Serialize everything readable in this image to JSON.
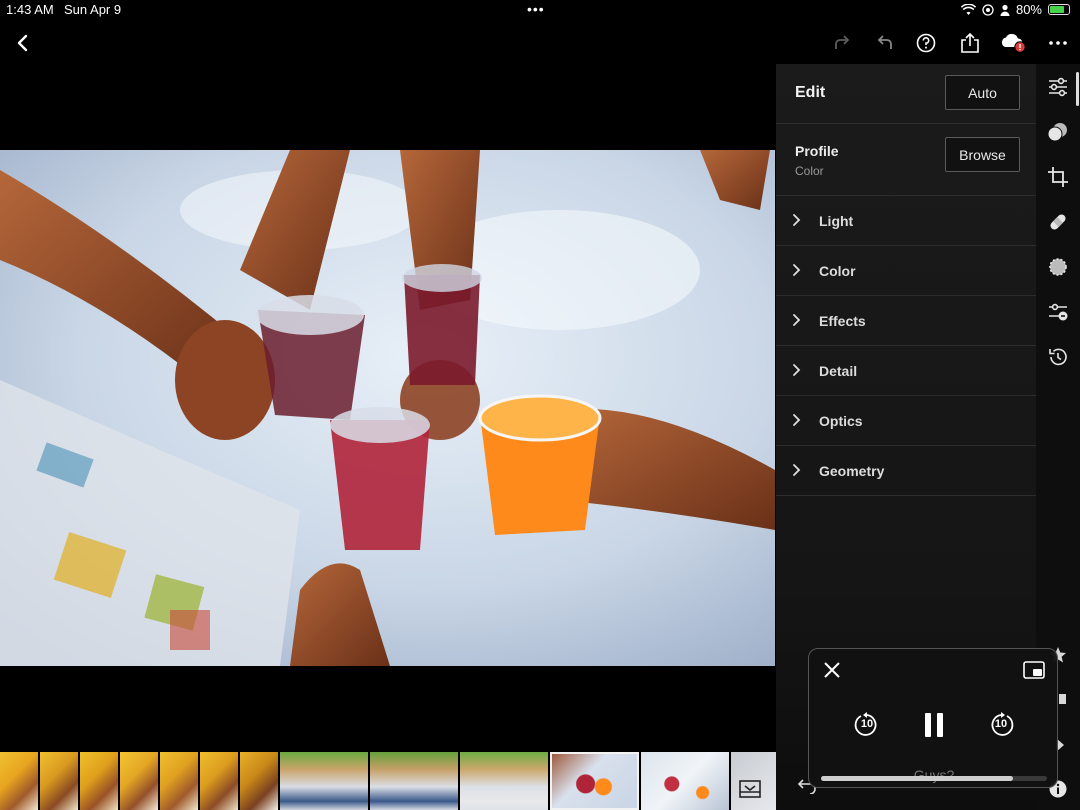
{
  "status_bar": {
    "time": "1:43 AM",
    "date": "Sun Apr 9",
    "battery": "80%",
    "battery_level": 0.8
  },
  "toolbar": {
    "back_icon": "chevron-left-icon",
    "redo_icon": "redo-icon",
    "undo_icon": "undo-icon",
    "help_icon": "help-icon",
    "share_icon": "share-icon",
    "cloud_icon": "cloud-sync-icon",
    "more_icon": "more-icon"
  },
  "edit_panel": {
    "title": "Edit",
    "auto_label": "Auto",
    "profile": {
      "label": "Profile",
      "value": "Color",
      "browse_label": "Browse"
    },
    "sections": [
      "Light",
      "Color",
      "Effects",
      "Detail",
      "Optics",
      "Geometry"
    ]
  },
  "tool_rail": {
    "icons": [
      "edit-sliders-icon",
      "presets-icon",
      "crop-icon",
      "healing-icon",
      "masking-icon",
      "versions-icon",
      "history-icon"
    ],
    "bottom_icons": [
      "star-icon",
      "flag-icon",
      "arrow-right-icon",
      "info-icon"
    ]
  },
  "mini_player": {
    "title": "Guys?",
    "skip_seconds": "10",
    "progress": 0.85
  },
  "colors": {
    "panel_bg": "#1b1b1b",
    "accent_red": "#e03a3a",
    "battery_green": "#48d14b"
  }
}
